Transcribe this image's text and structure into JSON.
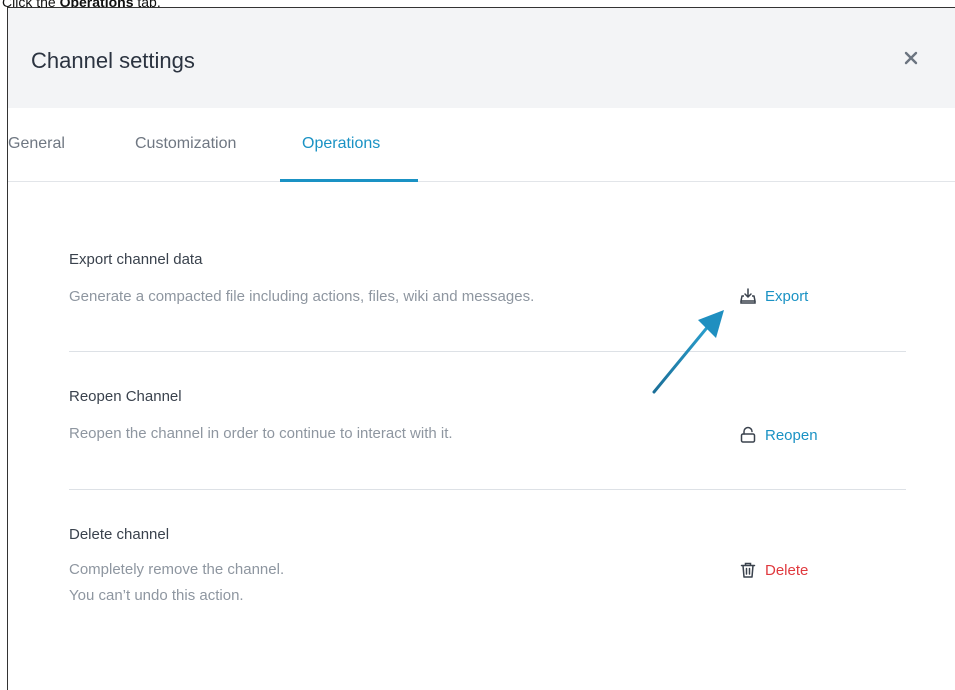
{
  "instruction": {
    "prefix": "Click the ",
    "target": "Operations",
    "suffix": " tab."
  },
  "dialog": {
    "title": "Channel settings"
  },
  "tabs": [
    {
      "label": "General",
      "active": false
    },
    {
      "label": "Customization",
      "active": false
    },
    {
      "label": "Operations",
      "active": true
    }
  ],
  "sections": [
    {
      "title": "Export channel data",
      "description": [
        "Generate a compacted file including actions, files, wiki and messages."
      ],
      "action": {
        "label": "Export",
        "icon": "export-icon",
        "color": "#1a92c4"
      }
    },
    {
      "title": "Reopen Channel",
      "description": [
        "Reopen the channel in order to continue to interact with it."
      ],
      "action": {
        "label": "Reopen",
        "icon": "lock-open-icon",
        "color": "#1a92c4"
      }
    },
    {
      "title": "Delete channel",
      "description": [
        "Completely remove the channel.",
        "You can’t undo this action."
      ],
      "action": {
        "label": "Delete",
        "icon": "trash-icon",
        "color": "#e0393e"
      }
    }
  ],
  "colors": {
    "accent": "#1a92c4",
    "danger": "#e0393e",
    "header_bg": "#f3f4f6"
  }
}
